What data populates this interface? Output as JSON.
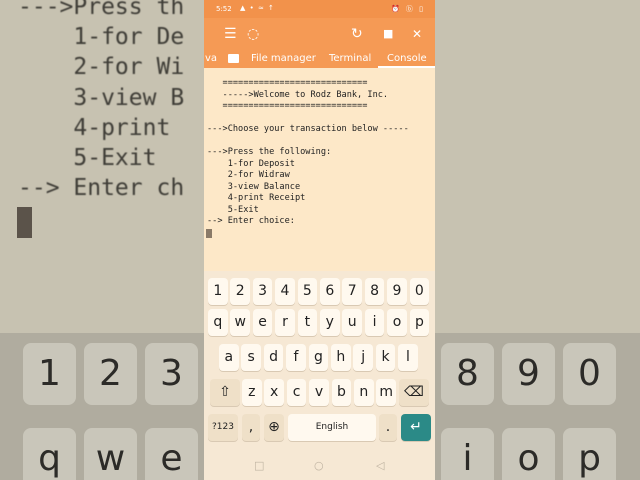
{
  "status_bar": {
    "time": "5:52",
    "icons_left": "▲ • ≈ ↑",
    "icons_right": "⏰ ⓑ ▯"
  },
  "toolbar": {
    "menu_icon": "☰",
    "spinner_icon": "◌",
    "refresh_icon": "↻",
    "stop_icon": "■",
    "close_icon": "✕"
  },
  "tabs": [
    {
      "label": "va"
    },
    {
      "label": "File manager"
    },
    {
      "label": "Terminal"
    },
    {
      "label": "Console"
    }
  ],
  "console_lines": [
    "   ============================",
    "   ----->Welcome to Rodz Bank, Inc.",
    "   ============================",
    "",
    "--->Choose your transaction below -----",
    "",
    "--->Press the following:",
    "    1-for Deposit",
    "    2-for Widraw",
    "    3-view Balance",
    "    4-print Receipt",
    "    5-Exit",
    "--> Enter choice:"
  ],
  "keyboard": {
    "row_numbers": [
      "1",
      "2",
      "3",
      "4",
      "5",
      "6",
      "7",
      "8",
      "9",
      "0"
    ],
    "row_q": [
      "q",
      "w",
      "e",
      "r",
      "t",
      "y",
      "u",
      "i",
      "o",
      "p"
    ],
    "row_a": [
      "a",
      "s",
      "d",
      "f",
      "g",
      "h",
      "j",
      "k",
      "l"
    ],
    "row_z": [
      "z",
      "x",
      "c",
      "v",
      "b",
      "n",
      "m"
    ],
    "shift_icon": "⇧",
    "backspace_icon": "⌫",
    "symbols_label": "?123",
    "comma_label": ",",
    "globe_icon": "⊕",
    "space_label": "English",
    "period_label": ".",
    "enter_icon": "↵"
  },
  "navbar": {
    "recents_icon": "□",
    "home_icon": "○",
    "back_icon": "◁"
  },
  "background_text": "--->Press th\n    1-for De\n    2-for Wi\n    3-view B\n    4-print\n    5-Exit\n--> Enter ch",
  "bg_keys": {
    "left_row1": [
      "1",
      "2",
      "3"
    ],
    "left_row2": [
      "q",
      "w",
      "e"
    ],
    "right_row1": [
      "8",
      "9",
      "0"
    ],
    "right_row2": [
      "i",
      "o",
      "p"
    ]
  },
  "colors": {
    "accent": "#f59a55",
    "console_bg": "#fde8c8",
    "enter_key": "#2b8a87"
  }
}
